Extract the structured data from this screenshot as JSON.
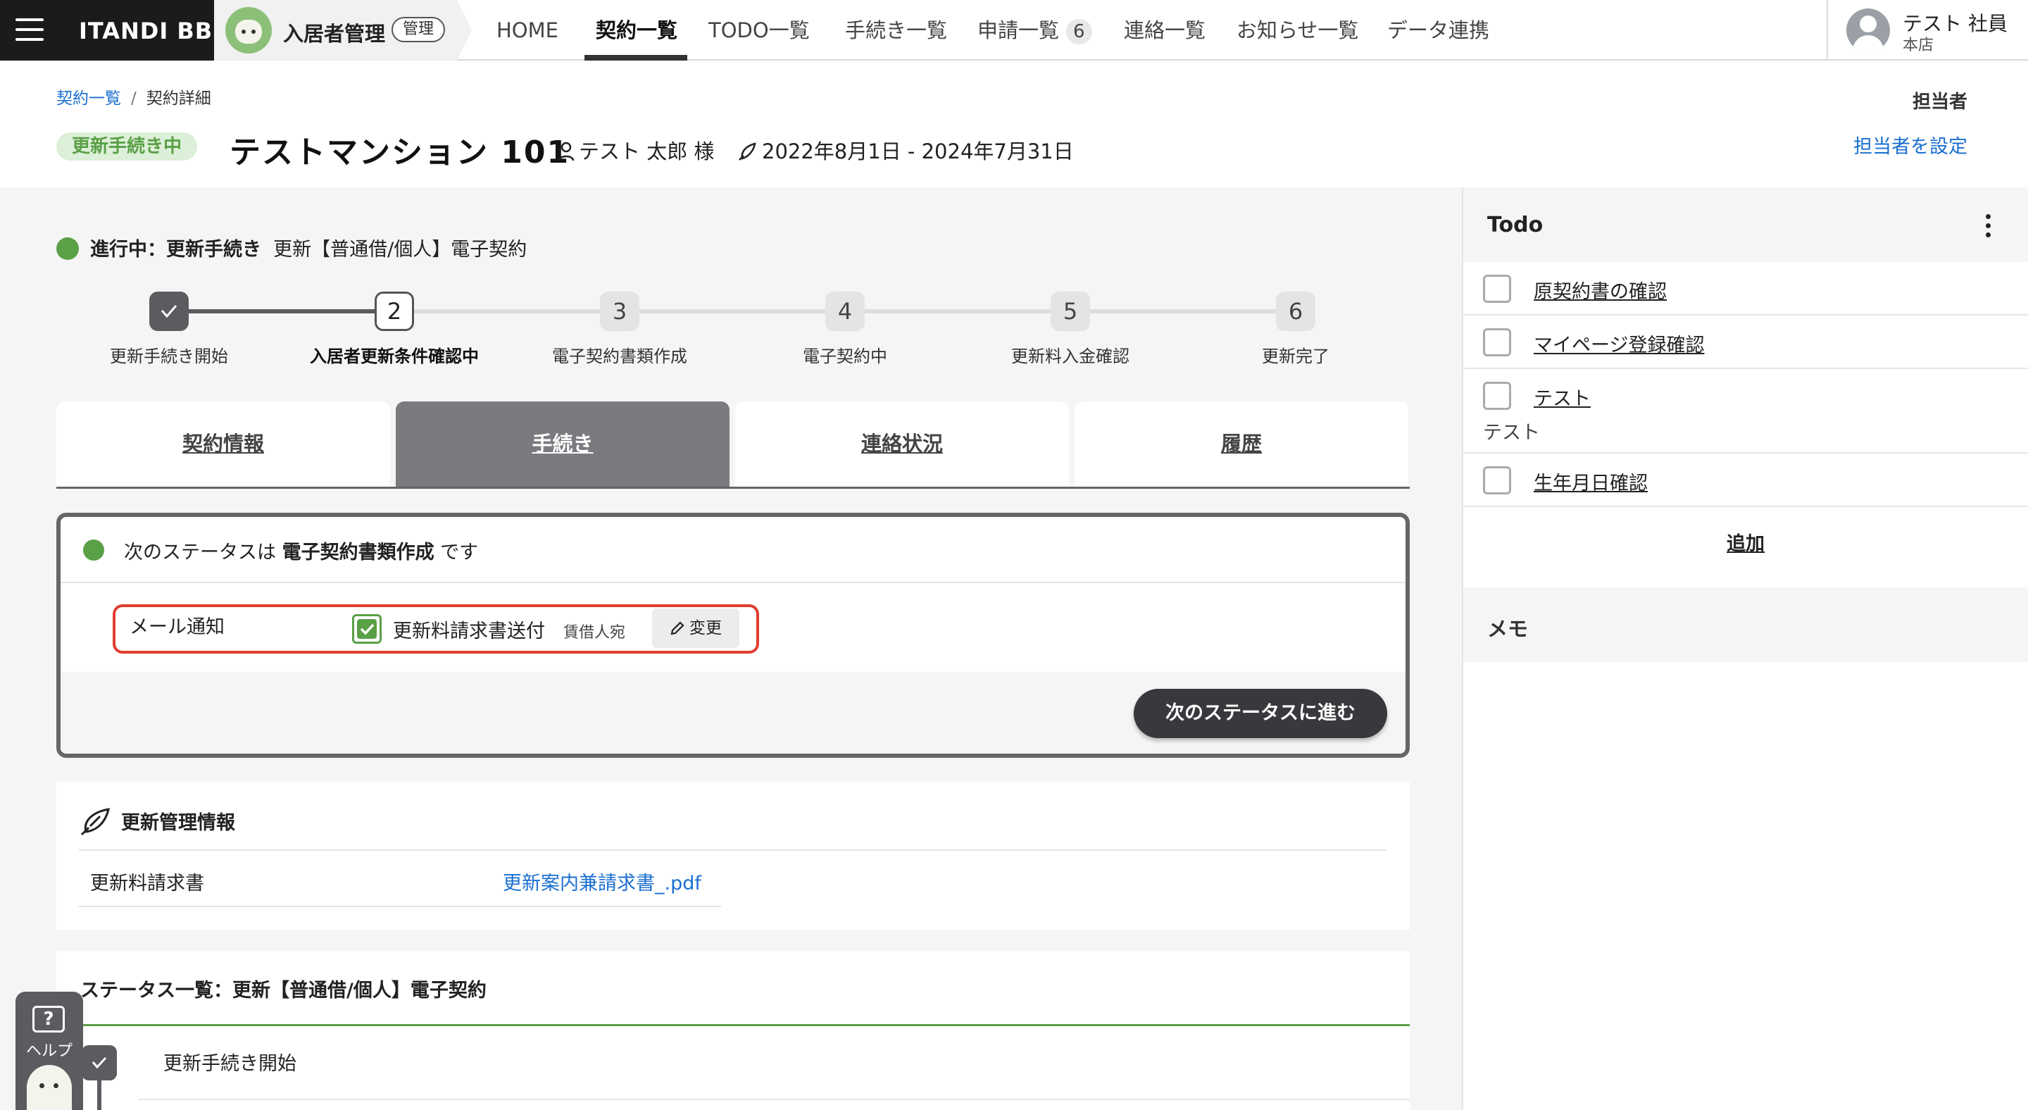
{
  "nav": {
    "brand": "ITANDI BB",
    "app_name": "入居者管理",
    "app_badge": "管理",
    "items": [
      {
        "label": "HOME"
      },
      {
        "label": "契約一覧"
      },
      {
        "label": "TODO一覧"
      },
      {
        "label": "手続き一覧"
      },
      {
        "label": "申請一覧",
        "count": "6"
      },
      {
        "label": "連絡一覧"
      },
      {
        "label": "お知らせ一覧"
      },
      {
        "label": "データ連携"
      }
    ],
    "active_index": 1,
    "user_name": "テスト 社員",
    "user_branch": "本店"
  },
  "header": {
    "breadcrumb": [
      "契約一覧",
      "契約詳細"
    ],
    "status": "更新手続き中",
    "property": "テストマンション 101",
    "tenant": "テスト 太郎 様",
    "period": "2022年8月1日 - 2024年7月31日",
    "assignee_label": "担当者",
    "assignee_link": "担当者を設定"
  },
  "progress": {
    "prefix": "進行中：更新手続き",
    "name": "更新【普通借/個人】電子契約",
    "steps": [
      {
        "label": "更新手続き開始",
        "num": "✓",
        "state": "done"
      },
      {
        "label": "入居者更新条件確認中",
        "num": "2",
        "state": "current"
      },
      {
        "label": "電子契約書類作成",
        "num": "3",
        "state": "todo"
      },
      {
        "label": "電子契約中",
        "num": "4",
        "state": "todo"
      },
      {
        "label": "更新料入金確認",
        "num": "5",
        "state": "todo"
      },
      {
        "label": "更新完了",
        "num": "6",
        "state": "todo"
      }
    ]
  },
  "tabs": [
    "契約情報",
    "手続き",
    "連絡状況",
    "履歴"
  ],
  "active_tab": 1,
  "next_status": {
    "pre": "次のステータスは ",
    "status": "電子契約書類作成",
    "post": " です",
    "mail_label": "メール通知",
    "mail_checked": true,
    "mail_item": "更新料請求書送付",
    "mail_recipient": "賃借人宛",
    "change_label": "変更",
    "next_button": "次のステータスに進む"
  },
  "renewal_mgmt": {
    "title": "更新管理情報",
    "key": "更新料請求書",
    "value": "更新案内兼請求書_.pdf"
  },
  "status_list": {
    "title": "ステータス一覧：更新【普通借/個人】電子契約",
    "first_item": "更新手続き開始"
  },
  "help": {
    "label": "ヘルプ"
  },
  "todo": {
    "title": "Todo",
    "items": [
      {
        "label": "原契約書の確認",
        "sub": ""
      },
      {
        "label": "マイページ登録確認",
        "sub": ""
      },
      {
        "label": "テスト",
        "sub": "テスト"
      },
      {
        "label": "生年月日確認",
        "sub": ""
      }
    ],
    "add_label": "追加"
  },
  "memo": {
    "title": "メモ"
  },
  "colors": {
    "accent_green": "#5aa046",
    "alert_red": "#e03d2f",
    "link_blue": "#1a6fd1",
    "dark": "#3a383d"
  }
}
